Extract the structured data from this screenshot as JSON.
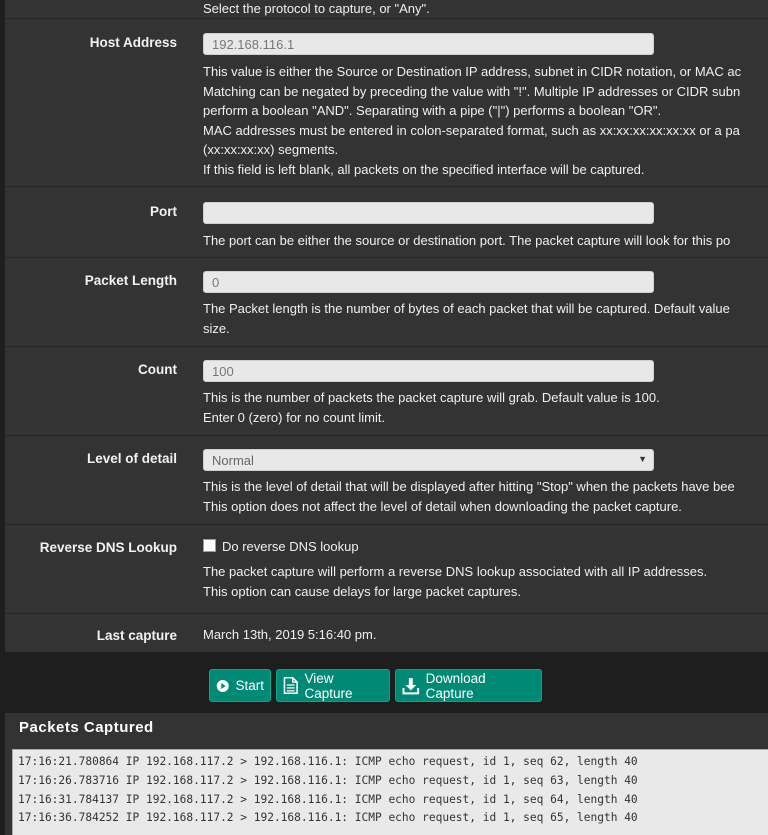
{
  "protocol": {
    "help_partial": "Select the protocol to capture, or \"Any\"."
  },
  "host_address": {
    "label": "Host Address",
    "value": "192.168.116.1",
    "help": [
      "This value is either the Source or Destination IP address, subnet in CIDR notation, or MAC ac",
      "Matching can be negated by preceding the value with \"!\". Multiple IP addresses or CIDR subn",
      "perform a boolean \"AND\". Separating with a pipe (\"|\") performs a boolean \"OR\".",
      "MAC addresses must be entered in colon-separated format, such as xx:xx:xx:xx:xx:xx or a pa",
      "(xx:xx:xx:xx) segments.",
      "If this field is left blank, all packets on the specified interface will be captured."
    ]
  },
  "port": {
    "label": "Port",
    "value": "",
    "help": [
      "The port can be either the source or destination port. The packet capture will look for this po"
    ]
  },
  "packet_length": {
    "label": "Packet Length",
    "value": "0",
    "help": [
      "The Packet length is the number of bytes of each packet that will be captured. Default value",
      "size."
    ]
  },
  "count": {
    "label": "Count",
    "value": "100",
    "help": [
      "This is the number of packets the packet capture will grab. Default value is 100.",
      "Enter 0 (zero) for no count limit."
    ]
  },
  "level_of_detail": {
    "label": "Level of detail",
    "selected": "Normal",
    "help": [
      "This is the level of detail that will be displayed after hitting \"Stop\" when the packets have bee",
      "This option does not affect the level of detail when downloading the packet capture."
    ]
  },
  "reverse_dns": {
    "label": "Reverse DNS Lookup",
    "checkbox_label": "Do reverse DNS lookup",
    "checked": false,
    "help": [
      "The packet capture will perform a reverse DNS lookup associated with all IP addresses.",
      "This option can cause delays for large packet captures."
    ]
  },
  "last_capture": {
    "label": "Last capture",
    "value": "March 13th, 2019 5:16:40 pm."
  },
  "buttons": {
    "start": "Start",
    "view": "View Capture",
    "download": "Download Capture"
  },
  "packets": {
    "title": "Packets Captured",
    "lines": [
      "17:16:21.780864 IP 192.168.117.2 > 192.168.116.1: ICMP echo request, id 1, seq 62, length 40",
      "17:16:26.783716 IP 192.168.117.2 > 192.168.116.1: ICMP echo request, id 1, seq 63, length 40",
      "17:16:31.784137 IP 192.168.117.2 > 192.168.116.1: ICMP echo request, id 1, seq 64, length 40",
      "17:16:36.784252 IP 192.168.117.2 > 192.168.116.1: ICMP echo request, id 1, seq 65, length 40"
    ]
  },
  "colors": {
    "panel": "#333333",
    "background": "#1e1e1e",
    "button": "#008a75"
  }
}
